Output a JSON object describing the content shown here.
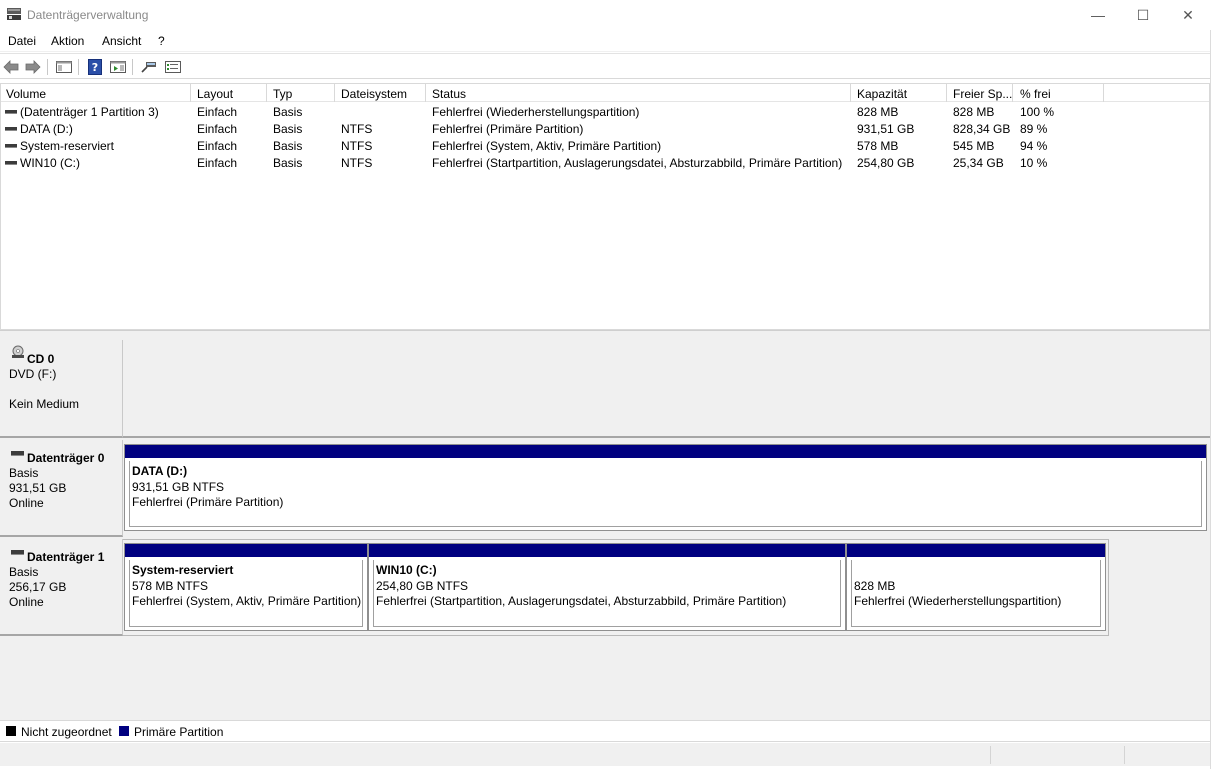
{
  "window": {
    "title": "Datenträgerverwaltung",
    "app_icon": "disk-management-icon",
    "controls": {
      "minimize": "—",
      "maximize": "☐",
      "close": "✕"
    }
  },
  "menu": [
    "Datei",
    "Aktion",
    "Ansicht",
    "?"
  ],
  "toolbar": {
    "buttons": [
      "back-arrow-icon",
      "forward-arrow-icon",
      "console-tree-icon",
      "help-icon",
      "action-pane-icon",
      "connect-icon",
      "properties-icon"
    ]
  },
  "volume_table": {
    "columns": [
      "Volume",
      "Layout",
      "Typ",
      "Dateisystem",
      "Status",
      "Kapazität",
      "Freier Sp...",
      "% frei"
    ],
    "rows": [
      [
        "(Datenträger 1 Partition 3)",
        "Einfach",
        "Basis",
        "",
        "Fehlerfrei (Wiederherstellungspartition)",
        "828 MB",
        "828 MB",
        "100 %"
      ],
      [
        "DATA (D:)",
        "Einfach",
        "Basis",
        "NTFS",
        "Fehlerfrei (Primäre Partition)",
        "931,51 GB",
        "828,34 GB",
        "89 %"
      ],
      [
        "System-reserviert",
        "Einfach",
        "Basis",
        "NTFS",
        "Fehlerfrei (System, Aktiv, Primäre Partition)",
        "578 MB",
        "545 MB",
        "94 %"
      ],
      [
        "WIN10 (C:)",
        "Einfach",
        "Basis",
        "NTFS",
        "Fehlerfrei (Startpartition, Auslagerungsdatei, Absturzabbild, Primäre Partition)",
        "254,80 GB",
        "25,34 GB",
        "10 %"
      ]
    ]
  },
  "disks": {
    "cd0": {
      "name": "CD 0",
      "line1": "DVD (F:)",
      "line2": "Kein Medium"
    },
    "disk0": {
      "name": "Datenträger 0",
      "type": "Basis",
      "size": "931,51 GB",
      "state": "Online",
      "partitions": [
        {
          "name": "DATA  (D:)",
          "size": "931,51 GB NTFS",
          "status": "Fehlerfrei (Primäre Partition)"
        }
      ]
    },
    "disk1": {
      "name": "Datenträger 1",
      "type": "Basis",
      "size": "256,17 GB",
      "state": "Online",
      "partitions": [
        {
          "name": "System-reserviert",
          "size": "578 MB NTFS",
          "status": "Fehlerfrei (System, Aktiv, Primäre Partition)"
        },
        {
          "name": "WIN10  (C:)",
          "size": "254,80 GB NTFS",
          "status": "Fehlerfrei (Startpartition, Auslagerungsdatei, Absturzabbild, Primäre Partition)"
        },
        {
          "name": "",
          "size": "828 MB",
          "status": "Fehlerfrei (Wiederherstellungspartition)"
        }
      ]
    }
  },
  "legend": [
    {
      "label": "Nicht zugeordnet",
      "color": "#000000"
    },
    {
      "label": "Primäre Partition",
      "color": "#000080"
    }
  ]
}
